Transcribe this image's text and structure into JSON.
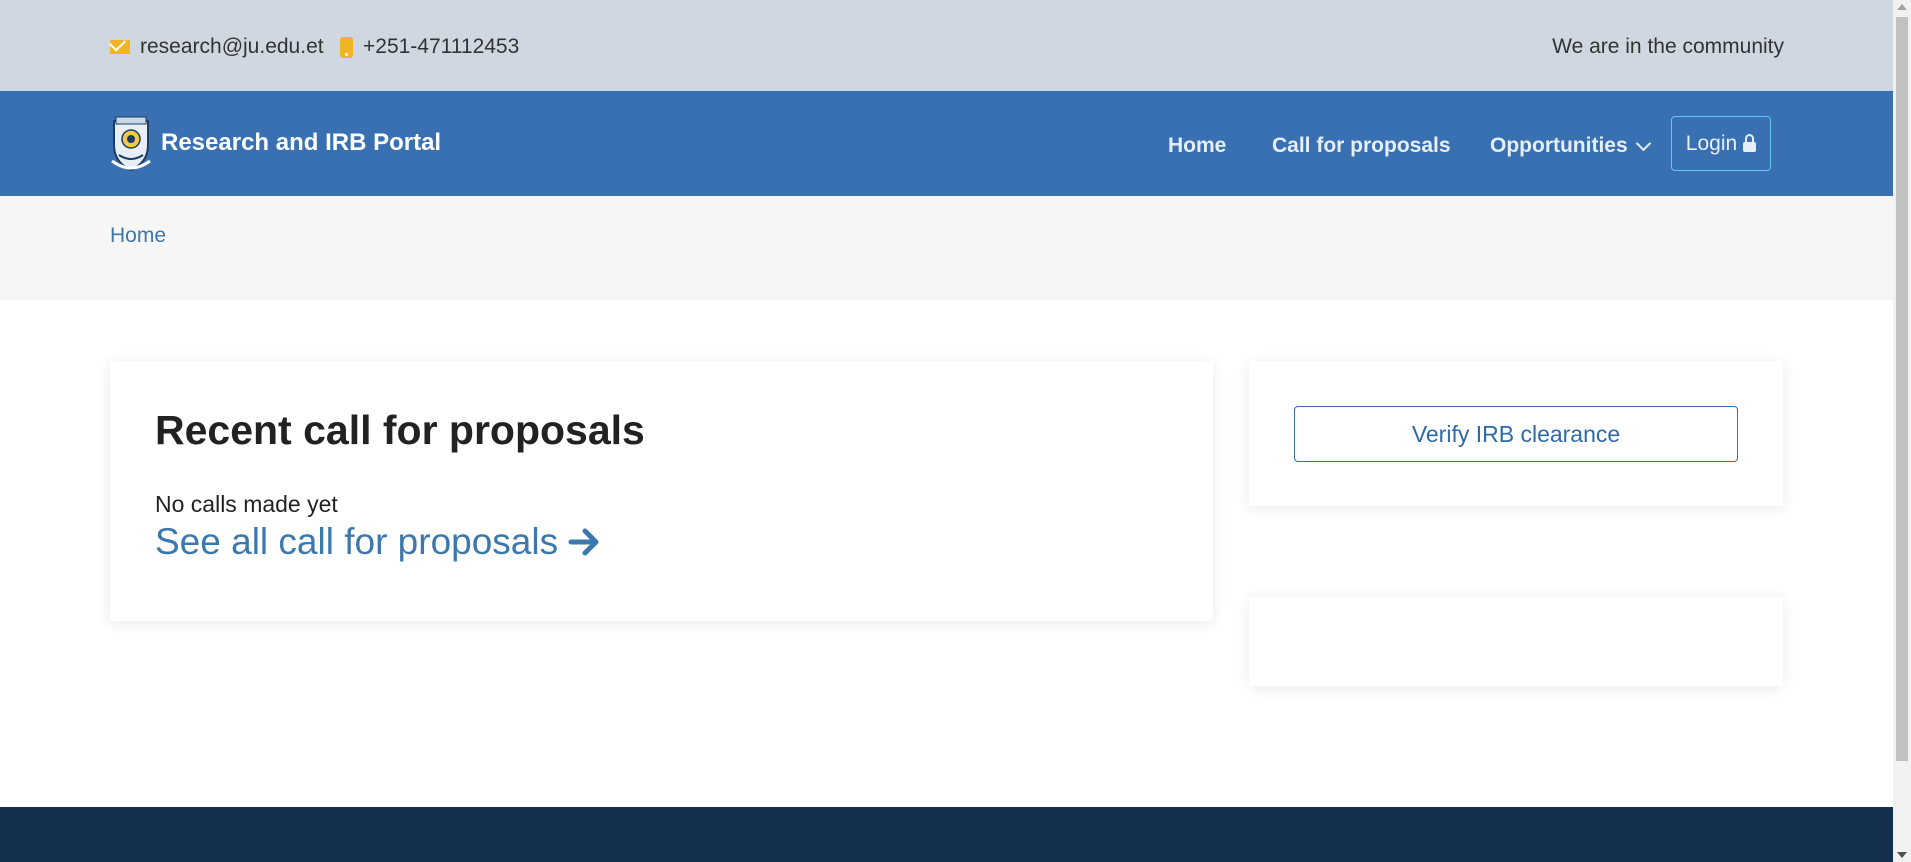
{
  "topbar": {
    "email": "research@ju.edu.et",
    "phone": "+251-471112453",
    "tagline": "We are in the community",
    "icon_color": "#f0b429"
  },
  "navbar": {
    "brand": "Research and IRB Portal",
    "links": {
      "home": "Home",
      "call_for_proposals": "Call for proposals",
      "opportunities": "Opportunities"
    },
    "login": "Login",
    "background": "#3870b1"
  },
  "breadcrumb": {
    "home": "Home"
  },
  "main": {
    "title": "Recent call for proposals",
    "empty_message": "No calls made yet",
    "see_all": "See all call for proposals"
  },
  "sidebar": {
    "verify_button": "Verify IRB clearance"
  },
  "footer": {
    "background": "#14304d"
  },
  "icons": [
    "mail-icon",
    "phone-icon",
    "logo-crest-icon",
    "chevron-down-icon",
    "lock-icon",
    "arrow-right-icon"
  ]
}
